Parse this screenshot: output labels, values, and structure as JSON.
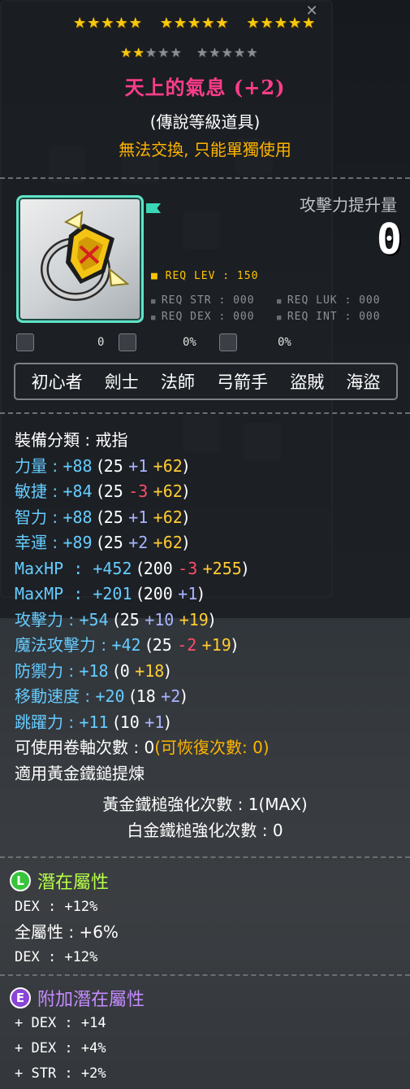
{
  "stars": {
    "row1_filled": 15,
    "row2_filled": 2,
    "row2_total": 10
  },
  "item": {
    "name": "天上的氣息 (+2)",
    "grade": "(傳說等級道具)",
    "trade": "無法交換, 只能單獨使用"
  },
  "attack_gain": {
    "label": "攻擊力提升量",
    "value": "0"
  },
  "requirements": {
    "level": "REQ LEV : 150",
    "str": "REQ STR : 000",
    "luk": "REQ LUK : 000",
    "dex": "REQ DEX : 000",
    "int": "REQ INT : 000"
  },
  "misc": {
    "value1": "0",
    "value2": "0%",
    "value3": "0%"
  },
  "jobs": [
    "初心者",
    "劍士",
    "法師",
    "弓箭手",
    "盜賊",
    "海盜"
  ],
  "stats": {
    "category": "裝備分類 : 戒指",
    "str": {
      "name": "力量",
      "sep": " : ",
      "total": "+88",
      "base": "25",
      "mid": "+1",
      "extra": "+62"
    },
    "dex": {
      "name": "敏捷",
      "sep": " : ",
      "total": "+84",
      "base": "25",
      "mid": "-3",
      "extra": "+62"
    },
    "int": {
      "name": "智力",
      "sep": " : ",
      "total": "+88",
      "base": "25",
      "mid": "+1",
      "extra": "+62"
    },
    "luk": {
      "name": "幸運",
      "sep": " : ",
      "total": "+89",
      "base": "25",
      "mid": "+2",
      "extra": "+62"
    },
    "hp": {
      "name": "MaxHP",
      "sep": " : ",
      "total": "+452",
      "base": "200",
      "mid": "-3",
      "extra": "+255"
    },
    "mp": {
      "name": "MaxMP",
      "sep": " : ",
      "total": "+201",
      "base": "200",
      "mid": "+1"
    },
    "atk": {
      "name": "攻擊力",
      "sep": " : ",
      "total": "+54",
      "base": "25",
      "mid": "+10",
      "extra": "+19"
    },
    "matk": {
      "name": "魔法攻擊力",
      "sep": " : ",
      "total": "+42",
      "base": "25",
      "mid": "-2",
      "extra": "+19"
    },
    "def": {
      "name": "防禦力",
      "sep": " : ",
      "total": "+18",
      "base": "0",
      "extra": "+18"
    },
    "speed": {
      "name": "移動速度",
      "sep": " : ",
      "total": "+20",
      "base": "18",
      "mid": "+2"
    },
    "jump": {
      "name": "跳躍力",
      "sep": " : ",
      "total": "+11",
      "base": "10",
      "mid": "+1"
    },
    "scroll": {
      "text": "可使用卷軸次數 : 0",
      "restore": "(可恢復次數: 0)"
    },
    "hammer": "適用黃金鐵鎚提煉"
  },
  "hammer": {
    "gold": "黃金鐵槌強化次數 : 1(MAX)",
    "platinum": "白金鐵槌強化次數 : 0"
  },
  "potential": {
    "badge": "L",
    "title": "潛在屬性",
    "lines": [
      "DEX : +12%",
      "全屬性 : +6%",
      "DEX : +12%"
    ],
    "badge_color": "#37c43b",
    "title_color": "#b6ff4a"
  },
  "additional": {
    "badge": "E",
    "title": "附加潛在屬性",
    "lines": [
      "+ DEX : +14",
      "+ DEX : +4%",
      "+ STR : +2%"
    ],
    "badge_color": "#8a44d6",
    "title_color": "#c58bff"
  }
}
